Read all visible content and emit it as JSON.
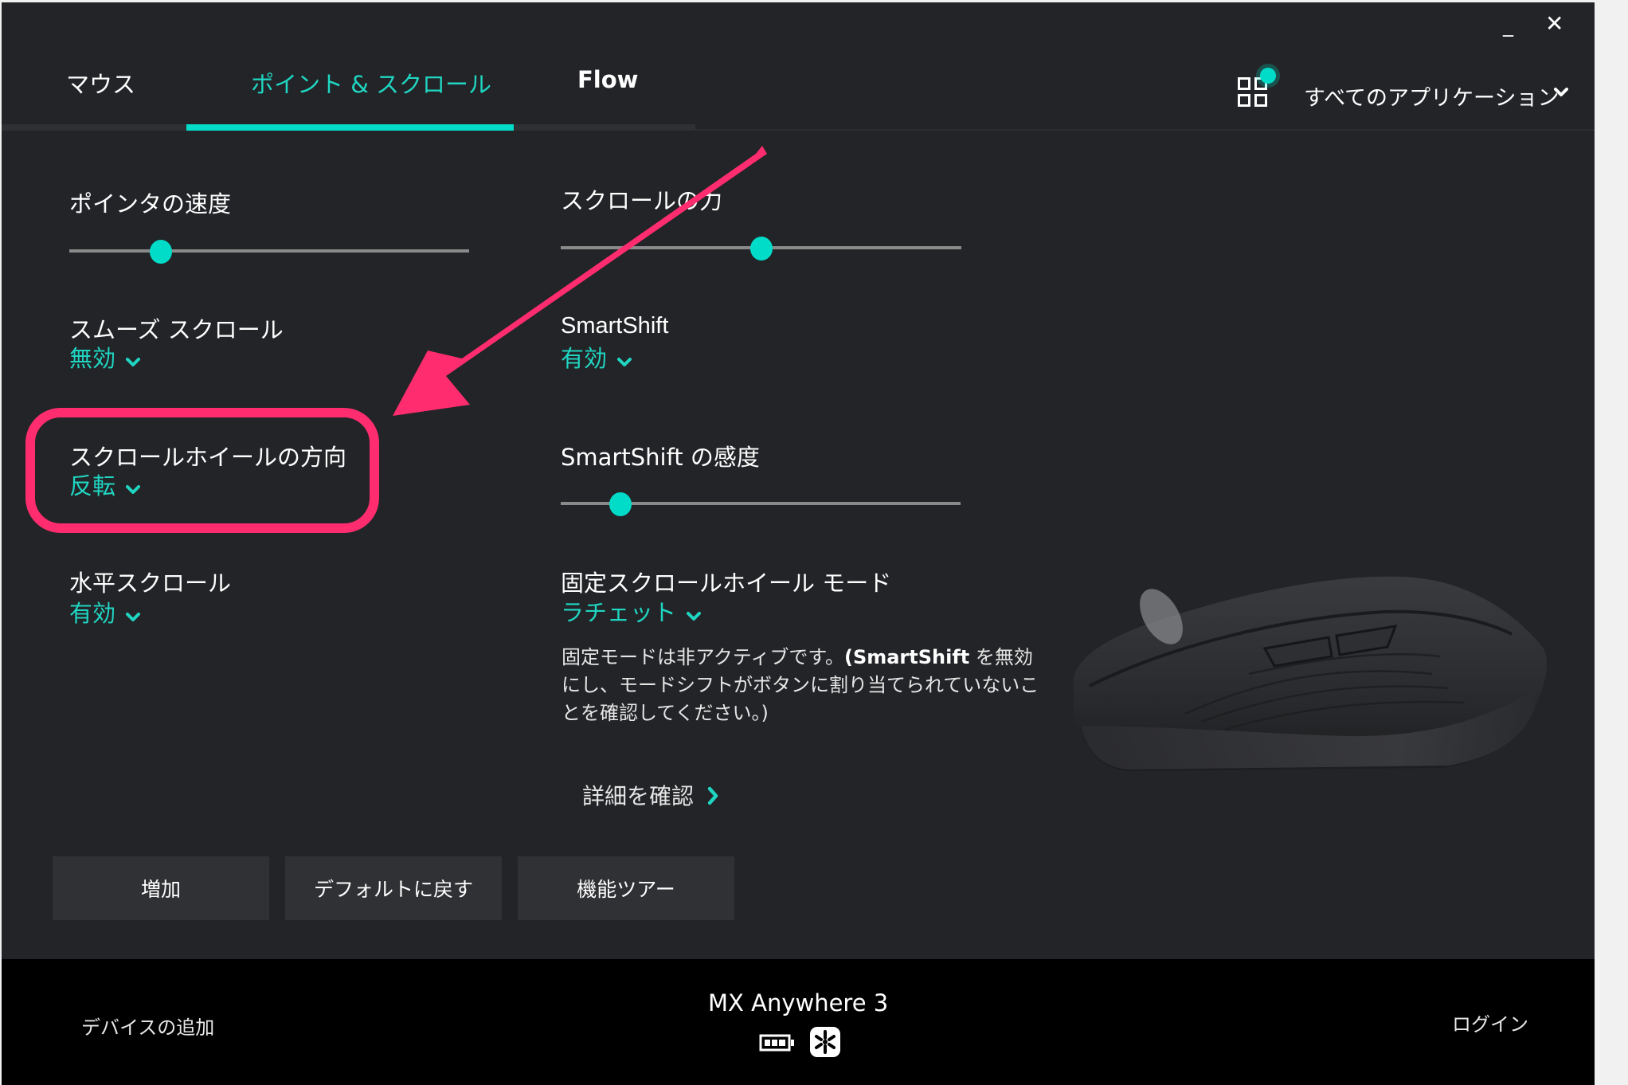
{
  "window": {
    "minimize_label": "_",
    "close_label": "✕"
  },
  "tabs": [
    {
      "label": "マウス",
      "active": false
    },
    {
      "label": "ポイント & スクロール",
      "active": true
    },
    {
      "label": "Flow",
      "active": false
    }
  ],
  "app_selector": {
    "label": "すべてのアプリケーション",
    "icon": "grid-icon",
    "badge_color": "#00dcc8"
  },
  "settings": {
    "pointer_speed": {
      "title": "ポインタの速度",
      "value_percent": 23
    },
    "scroll_force": {
      "title": "スクロールの力",
      "value_percent": 50
    },
    "smooth_scroll": {
      "title": "スムーズ スクロール",
      "value": "無効"
    },
    "smartshift": {
      "title": "SmartShift",
      "value": "有効"
    },
    "wheel_direction": {
      "title": "スクロールホイールの方向",
      "value": "反転"
    },
    "smartshift_sensitivity": {
      "title": "SmartShift の感度",
      "value_percent": 15
    },
    "horizontal_scroll": {
      "title": "水平スクロール",
      "value": "有効"
    },
    "fixed_wheel_mode": {
      "title": "固定スクロールホイール モード",
      "value": "ラチェット",
      "description_lines": [
        "固定モードは非アクティブです。",
        "(SmartShift",
        " を無効にし、モードシフトがボタンに割り当てられていないことを確認してください。)"
      ]
    }
  },
  "more_link": {
    "label": "詳細を確認",
    "icon": "chevron-right-icon"
  },
  "buttons": {
    "add": "増加",
    "reset_default": "デフォルトに戻す",
    "feature_tour": "機能ツアー"
  },
  "footer": {
    "add_device": "デバイスの追加",
    "device_name": "MX Anywhere 3",
    "battery_icon": "battery-full-icon",
    "receiver_icon": "unifying-receiver-icon",
    "login": "ログイン"
  },
  "colors": {
    "accent": "#00dcc8",
    "background": "#232427",
    "footer": "#000000",
    "annotation": "#ff2d6f"
  }
}
